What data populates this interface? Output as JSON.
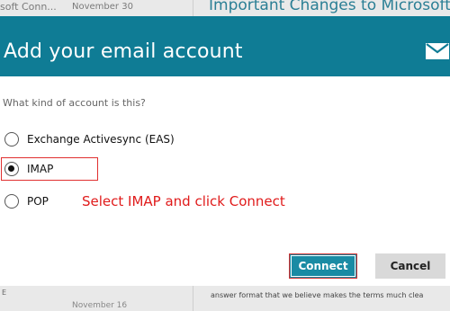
{
  "background": {
    "top_sender": "soft Conn...",
    "top_date": "November 30",
    "top_subject": "Important Changes to Microsoft S",
    "bottom_letter": "E",
    "bottom_date": "November 16",
    "bottom_excerpt": "answer format that we believe makes the terms much clea"
  },
  "dialog": {
    "title": "Add your email account",
    "question": "What kind of account is this?",
    "options": [
      {
        "label": "Exchange Activesync (EAS)",
        "selected": false
      },
      {
        "label": "IMAP",
        "selected": true
      },
      {
        "label": "POP",
        "selected": false
      }
    ],
    "instruction": "Select IMAP and click Connect",
    "connect_label": "Connect",
    "cancel_label": "Cancel"
  },
  "colors": {
    "header": "#0f7c95",
    "connect": "#1a8ba4",
    "annotation": "#e01b1b"
  },
  "icons": {
    "header_icon": "mail-envelope-icon"
  }
}
